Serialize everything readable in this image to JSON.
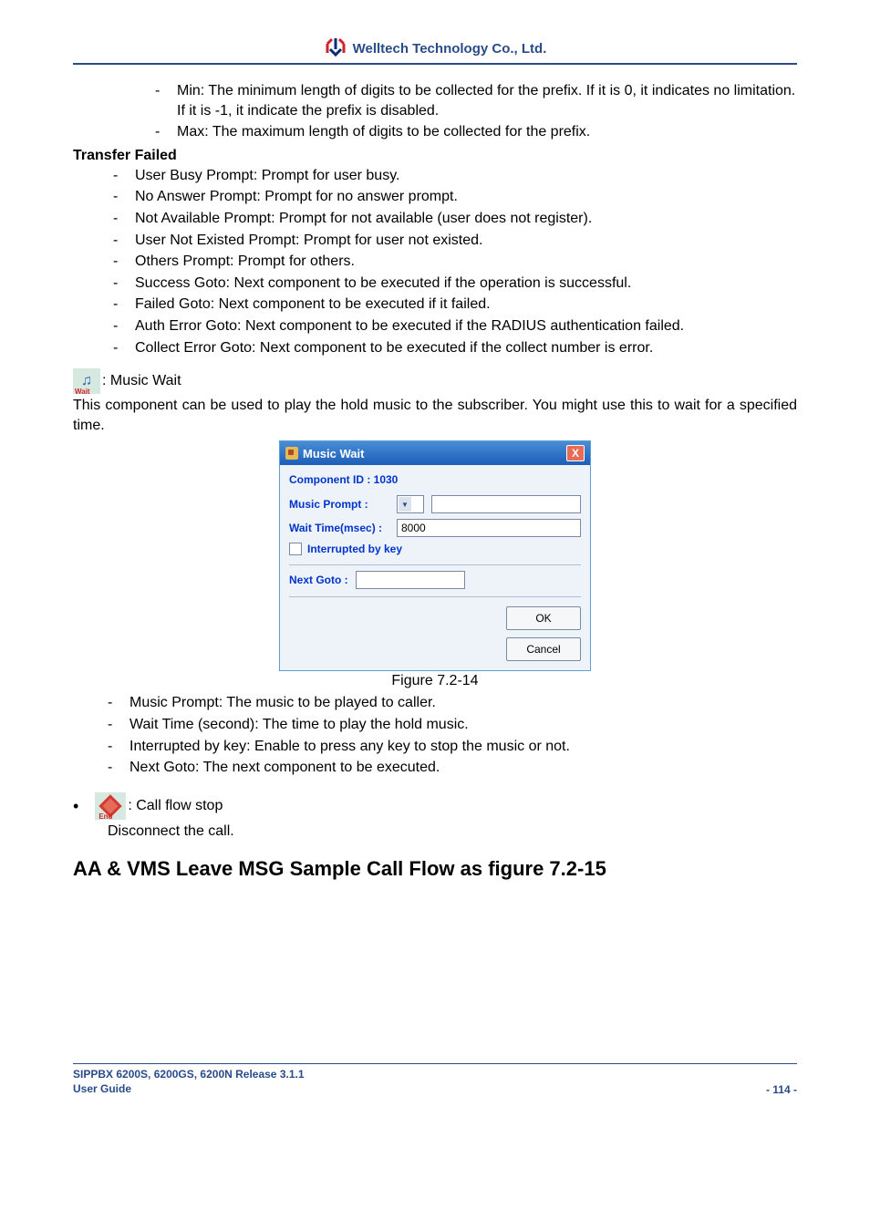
{
  "header": {
    "company": "Welltech Technology Co., Ltd."
  },
  "top_items": [
    "Min: The minimum length of digits to be collected for the prefix. If it is 0, it indicates no limitation. If it is -1, it indicate the prefix is disabled.",
    "Max: The maximum length of digits to be collected for the prefix."
  ],
  "tf": {
    "head": "Transfer Failed",
    "items": [
      "User Busy Prompt: Prompt for user busy.",
      "No Answer Prompt: Prompt for no answer prompt.",
      "Not Available Prompt: Prompt for not available (user does not register).",
      "User Not Existed Prompt: Prompt for user not existed.",
      "Others Prompt: Prompt for others.",
      "Success Goto: Next component to be executed if the operation is successful.",
      "Failed Goto: Next component to be executed if it failed.",
      "Auth Error Goto: Next component to be executed if the RADIUS authentication failed.",
      "Collect Error Goto: Next component to be executed if the collect number is error."
    ]
  },
  "music": {
    "icon_sub": "Wait",
    "label": ": Music Wait",
    "desc": "This component can be used to play the hold music to the subscriber. You might use this to wait for a specified time."
  },
  "dialog": {
    "title": "Music Wait",
    "close": "X",
    "comp_label": "Component ID : ",
    "comp_val": "1030",
    "music_prompt": "Music Prompt :",
    "wait_label": "Wait Time(msec) :",
    "wait_val": "8000",
    "chk_label": "Interrupted by key",
    "next_goto": "Next Goto :",
    "ok": "OK",
    "cancel": "Cancel"
  },
  "fig_cap": "Figure 7.2-14",
  "after_fig": [
    "Music Prompt: The music to be played to caller.",
    "Wait Time (second): The time to play the hold music.",
    "Interrupted by key: Enable to press any key to stop the music or not.",
    "Next Goto: The next component to be executed."
  ],
  "callflow": {
    "icon_sub": "End",
    "label": ": Call flow stop",
    "disc": "Disconnect the call."
  },
  "major_head": "AA & VMS Leave MSG Sample Call Flow as figure 7.2-15",
  "footer": {
    "l1": "SIPPBX 6200S, 6200GS, 6200N Release 3.1.1",
    "l2": "User Guide",
    "page": "- 114 -"
  }
}
